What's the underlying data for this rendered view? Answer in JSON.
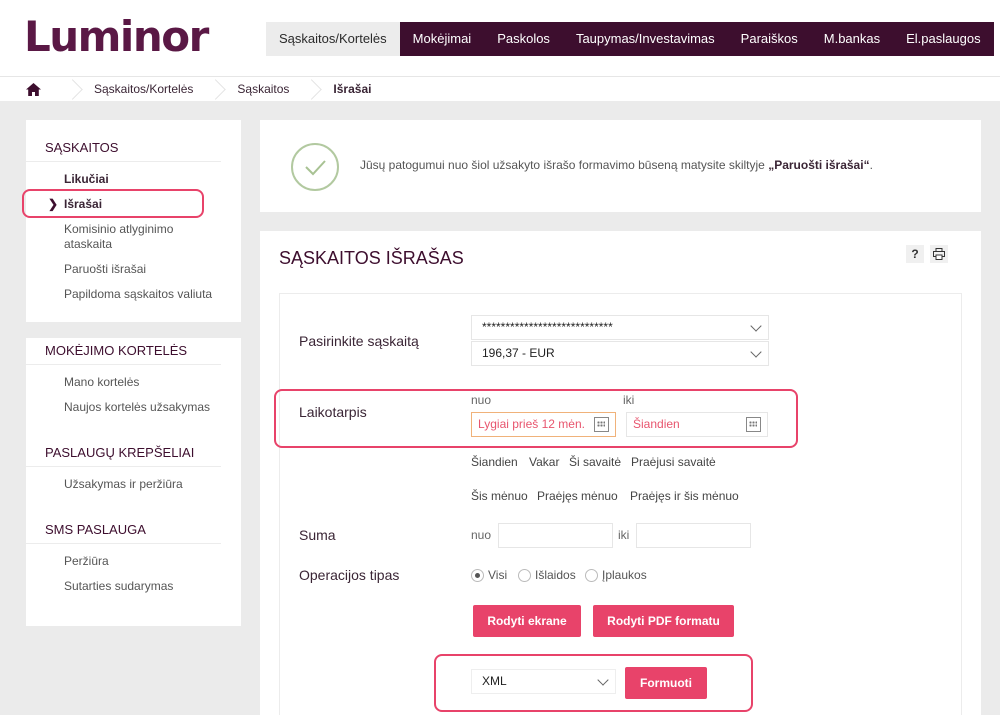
{
  "brand": {
    "logo": "Luminor",
    "accent": "#3d0e2e",
    "pink": "#e8436a"
  },
  "nav": {
    "items": [
      {
        "label": "Sąskaitos/Kortelės",
        "active": true
      },
      {
        "label": "Mokėjimai"
      },
      {
        "label": "Paskolos"
      },
      {
        "label": "Taupymas/Investavimas"
      },
      {
        "label": "Paraiškos"
      },
      {
        "label": "M.bankas"
      },
      {
        "label": "El.paslaugos"
      }
    ]
  },
  "breadcrumb": [
    "Sąskaitos/Kortelės",
    "Sąskaitos",
    "Išrašai"
  ],
  "sidebar": {
    "sections": [
      {
        "title": "SĄSKAITOS",
        "items": [
          "Likučiai",
          "Išrašai",
          "Komisinio atlyginimo ataskaita",
          "Paruošti išrašai",
          "Papildoma sąskaitos valiuta"
        ]
      },
      {
        "title": "MOKĖJIMO KORTELĖS",
        "items": [
          "Mano kortelės",
          "Naujos kortelės užsakymas"
        ]
      },
      {
        "title": "PASLAUGŲ KREPŠELIAI",
        "items": [
          "Užsakymas ir peržiūra"
        ]
      },
      {
        "title": "SMS PASLAUGA",
        "items": [
          "Peržiūra",
          "Sutarties sudarymas"
        ]
      }
    ]
  },
  "notice": {
    "text": "Jūsų patogumui nuo šiol užsakyto išrašo formavimo būseną matysite skiltyje ",
    "link": "„Paruošti išrašai“",
    "end": "."
  },
  "panel": {
    "title": "SĄSKAITOS IŠRAŠAS",
    "help": "?",
    "account_label": "Pasirinkite sąskaitą",
    "account_value": "****************************",
    "balance_value": "196,37 - EUR",
    "period_label": "Laikotarpis",
    "from_label": "nuo",
    "to_label": "iki",
    "from_value": "Lygiai prieš 12 mėn.",
    "to_value": "Šiandien",
    "quick_row1": [
      "Šiandien",
      "Vakar",
      "Ši savaitė",
      "Praėjusi savaitė"
    ],
    "quick_row2": [
      "Šis mėnuo",
      "Praėjęs mėnuo",
      "Praėjęs ir šis mėnuo"
    ],
    "amount_label": "Suma",
    "amount_from": "nuo",
    "amount_to": "iki",
    "op_label": "Operacijos tipas",
    "op_options": [
      "Visi",
      "Išlaidos",
      "Įplaukos"
    ],
    "btn_screen": "Rodyti ekrane",
    "btn_pdf": "Rodyti PDF formatu",
    "format_value": "XML",
    "btn_form": "Formuoti"
  }
}
